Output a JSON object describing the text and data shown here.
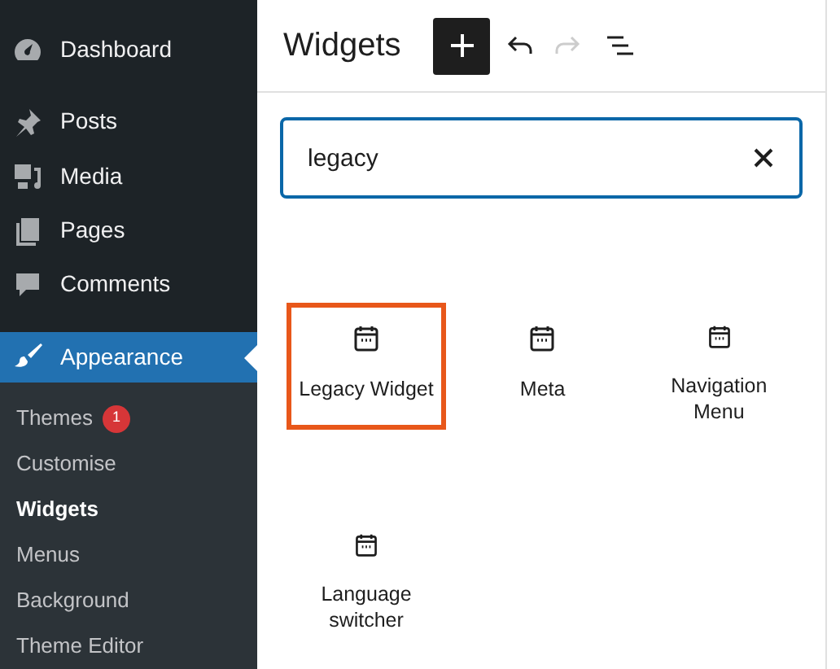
{
  "sidebar": {
    "items": [
      {
        "kind": "dashboard",
        "label": "Dashboard",
        "selected": false
      },
      {
        "kind": "posts",
        "label": "Posts",
        "selected": false
      },
      {
        "kind": "media",
        "label": "Media",
        "selected": false
      },
      {
        "kind": "pages",
        "label": "Pages",
        "selected": false
      },
      {
        "kind": "comments",
        "label": "Comments",
        "selected": false
      },
      {
        "kind": "appearance",
        "label": "Appearance",
        "selected": true
      }
    ],
    "submenu": [
      {
        "label": "Themes",
        "badge": "1",
        "selected": false
      },
      {
        "label": "Customise",
        "selected": false
      },
      {
        "label": "Widgets",
        "selected": true
      },
      {
        "label": "Menus",
        "selected": false
      },
      {
        "label": "Background",
        "selected": false
      },
      {
        "label": "Theme Editor",
        "selected": false
      }
    ]
  },
  "header": {
    "title": "Widgets",
    "redo_disabled": true
  },
  "search": {
    "value": "legacy"
  },
  "blocks": [
    {
      "label": "Legacy Widget",
      "highlighted": true
    },
    {
      "label": "Meta",
      "highlighted": false
    },
    {
      "label": "Navigation Menu",
      "highlighted": false
    },
    {
      "label": "Language switcher",
      "highlighted": false
    }
  ]
}
